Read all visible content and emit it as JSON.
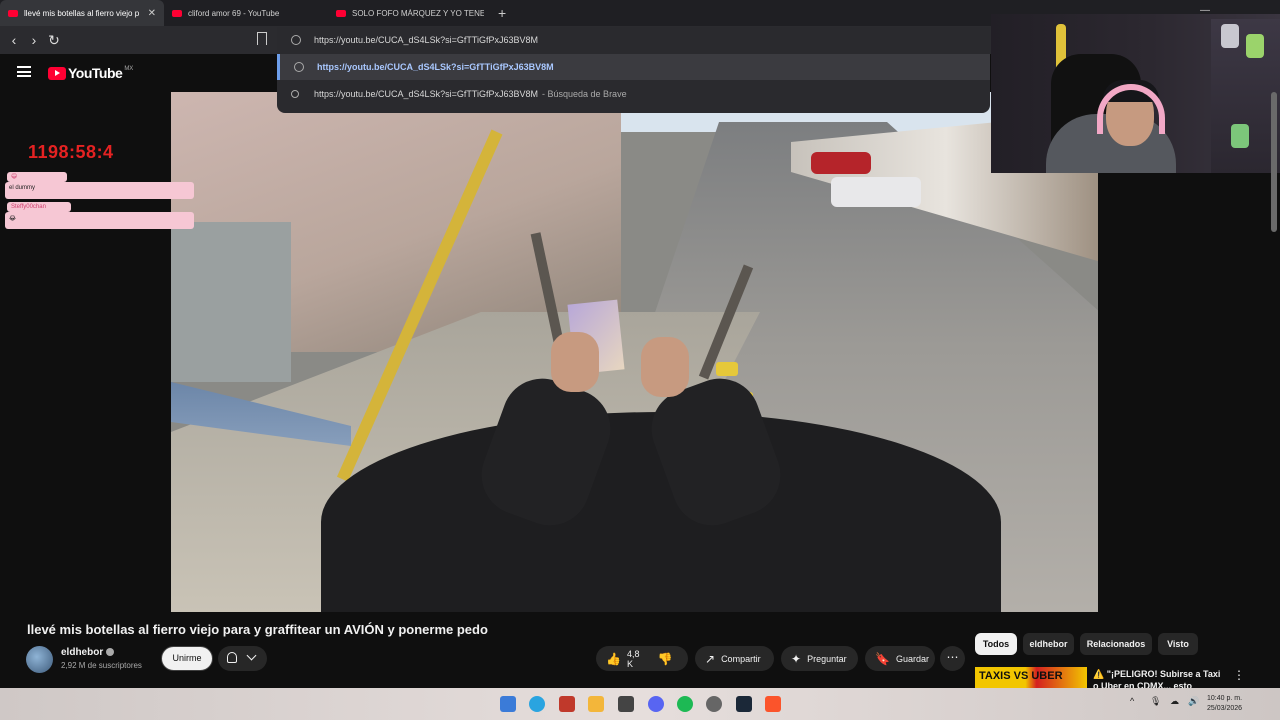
{
  "browser": {
    "tabs": [
      {
        "title": "llevé mis botellas al fierro viejo p",
        "active": true
      },
      {
        "title": "cliford amor 69 - YouTube",
        "active": false
      },
      {
        "title": "SOLO FOFO MÁRQUEZ Y YO TENEMO",
        "active": false
      }
    ],
    "close_glyph": "✕",
    "newtab_glyph": "+",
    "minimize_glyph": "—",
    "back_glyph": "‹",
    "forward_glyph": "›",
    "reload_glyph": "↻",
    "address_value": "https://youtu.be/CUCA_dS4LSk?si=GfTTiGfPxJ63BV8M",
    "suggestions": [
      {
        "url": "https://youtu.be/CUCA_dS4LSk?si=GfTTiGfPxJ63BV8M",
        "suffix": "",
        "selected": true
      },
      {
        "url": "https://youtu.be/CUCA_dS4LSk?si=GfTTiGfPxJ63BV8M",
        "suffix": "- Búsqueda de Brave",
        "selected": false
      }
    ]
  },
  "youtube": {
    "logo_text": "YouTube",
    "country_code": "MX"
  },
  "overlay": {
    "timer": "1198:58:4",
    "chat": [
      {
        "user": "",
        "message": "el dummy"
      },
      {
        "user": "Steffy00chan",
        "message": ""
      }
    ]
  },
  "video": {
    "title": "llevé mis botellas al fierro viejo para y graffitear un AVIÓN y ponerme pedo",
    "channel": "eldhebor",
    "subscribers": "2,92 M de suscriptores",
    "join_label": "Unirme",
    "likes": "4,8 K",
    "like_glyph": "👍",
    "dislike_glyph": "👎",
    "share_label": "Compartir",
    "share_glyph": "↗",
    "ask_label": "Preguntar",
    "ask_glyph": "✦",
    "save_label": "Guardar",
    "save_glyph": "🔖",
    "more_glyph": "⋯"
  },
  "sidebar": {
    "chips": [
      "Todos",
      "eldhebor",
      "Relacionados",
      "Visto"
    ],
    "related": {
      "thumb_text": "TAXIS VS UBER",
      "title": "⚠️ \"¡PELIGRO! Subirse a Taxi o Uber en CDMX... esto descubrí",
      "menu_glyph": "⋮"
    }
  },
  "taskbar": {
    "time": "10:40 p. m.",
    "date": "25/03/2026",
    "tray_caret": "^",
    "tray_icons": [
      "🎙",
      "☁",
      "🔊"
    ]
  },
  "colors": {
    "youtube_red": "#ff0033",
    "timer_red": "#e52222",
    "chat_pink": "#f6c7d4",
    "link_blue": "#a9c8ff"
  }
}
